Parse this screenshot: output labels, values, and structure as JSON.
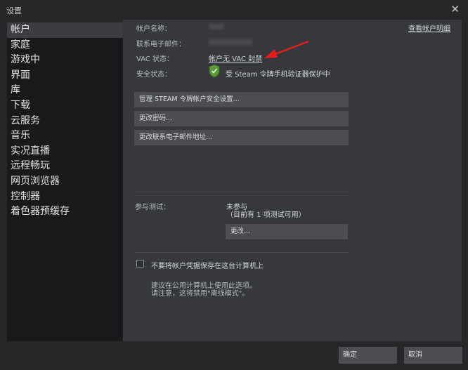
{
  "window": {
    "title": "设置",
    "close_glyph": "✕"
  },
  "sidebar": {
    "items": [
      {
        "label": "帐户",
        "active": true
      },
      {
        "label": "家庭"
      },
      {
        "label": "游戏中"
      },
      {
        "label": "界面"
      },
      {
        "label": "库"
      },
      {
        "label": "下载"
      },
      {
        "label": "云服务"
      },
      {
        "label": "音乐"
      },
      {
        "label": "实况直播"
      },
      {
        "label": "远程畅玩"
      },
      {
        "label": "网页浏览器"
      },
      {
        "label": "控制器"
      },
      {
        "label": "着色器预缓存"
      }
    ]
  },
  "account": {
    "name_label": "帐户名称：",
    "email_label": "联系电子邮件：",
    "vac_label": "VAC 状态：",
    "vac_value": "帐户无 VAC 封禁",
    "security_label": "安全状态：",
    "security_value": "受 Steam 令牌手机验证器保护中",
    "view_details_link": "查看帐户明细"
  },
  "buttons": {
    "manage_guard": "管理 STEAM 令牌帐户安全设置...",
    "change_password": "更改密码...",
    "change_email": "更改联系电子邮件地址..."
  },
  "beta": {
    "label": "参与测试：",
    "status": "未参与",
    "note": "（目前有 1 项测试可用）",
    "change_button": "更改..."
  },
  "remember": {
    "checkbox_label": "不要将帐户凭据保存在这台计算机上",
    "checked": false,
    "hint_line1": "建议在公用计算机上使用此选项。",
    "hint_line2": "请注意，这将禁用\"离线模式\"。"
  },
  "footer": {
    "ok": "确定",
    "cancel": "取消"
  },
  "colors": {
    "accent_arrow": "#e02020",
    "shield": "#5a9a3c"
  },
  "icons": {
    "shield": "shield-check-icon",
    "arrow": "red-arrow-annotation"
  }
}
